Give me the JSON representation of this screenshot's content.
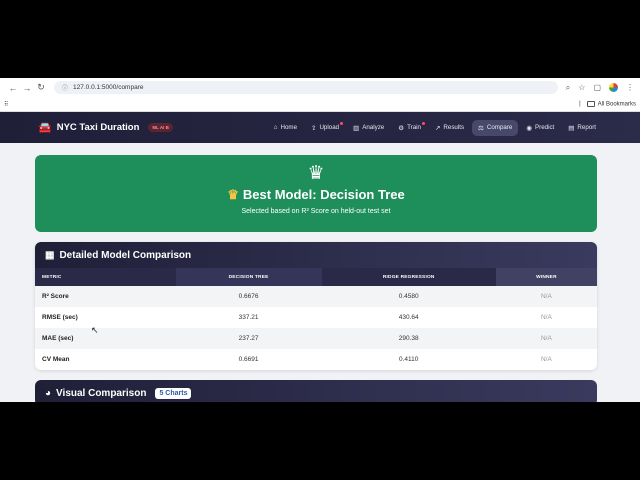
{
  "browser": {
    "url": "127.0.0.1:5000/compare",
    "bookmarks_label": "All Bookmarks"
  },
  "navbar": {
    "brand": "NYC Taxi Duration",
    "badge": "ML AI B",
    "links": [
      {
        "label": "Home",
        "icon": "home-icon",
        "glyph": "⌂"
      },
      {
        "label": "Upload",
        "icon": "upload-icon",
        "glyph": "⇪"
      },
      {
        "label": "Analyze",
        "icon": "chart-icon",
        "glyph": "▥"
      },
      {
        "label": "Train",
        "icon": "robot-icon",
        "glyph": "⚙"
      },
      {
        "label": "Results",
        "icon": "line-chart-icon",
        "glyph": "↗"
      },
      {
        "label": "Compare",
        "icon": "compare-icon",
        "glyph": "⚖"
      },
      {
        "label": "Predict",
        "icon": "predict-icon",
        "glyph": "◉"
      },
      {
        "label": "Report",
        "icon": "report-icon",
        "glyph": "▤"
      }
    ]
  },
  "hero": {
    "crown": "♛",
    "title": "Best Model: Decision Tree",
    "subtitle": "Selected based on R² Score on held-out test set"
  },
  "comparison": {
    "title": "Detailed Model Comparison",
    "columns": [
      "METRIC",
      "DECISION TREE",
      "RIDGE REGRESSION",
      "WINNER"
    ],
    "rows": [
      [
        "R² Score",
        "0.6676",
        "0.4580",
        "N/A"
      ],
      [
        "RMSE (sec)",
        "337.21",
        "430.64",
        "N/A"
      ],
      [
        "MAE (sec)",
        "237.27",
        "290.38",
        "N/A"
      ],
      [
        "CV Mean",
        "0.6691",
        "0.4110",
        "N/A"
      ]
    ]
  },
  "visual": {
    "title": "Visual Comparison",
    "count": "5 Charts"
  }
}
